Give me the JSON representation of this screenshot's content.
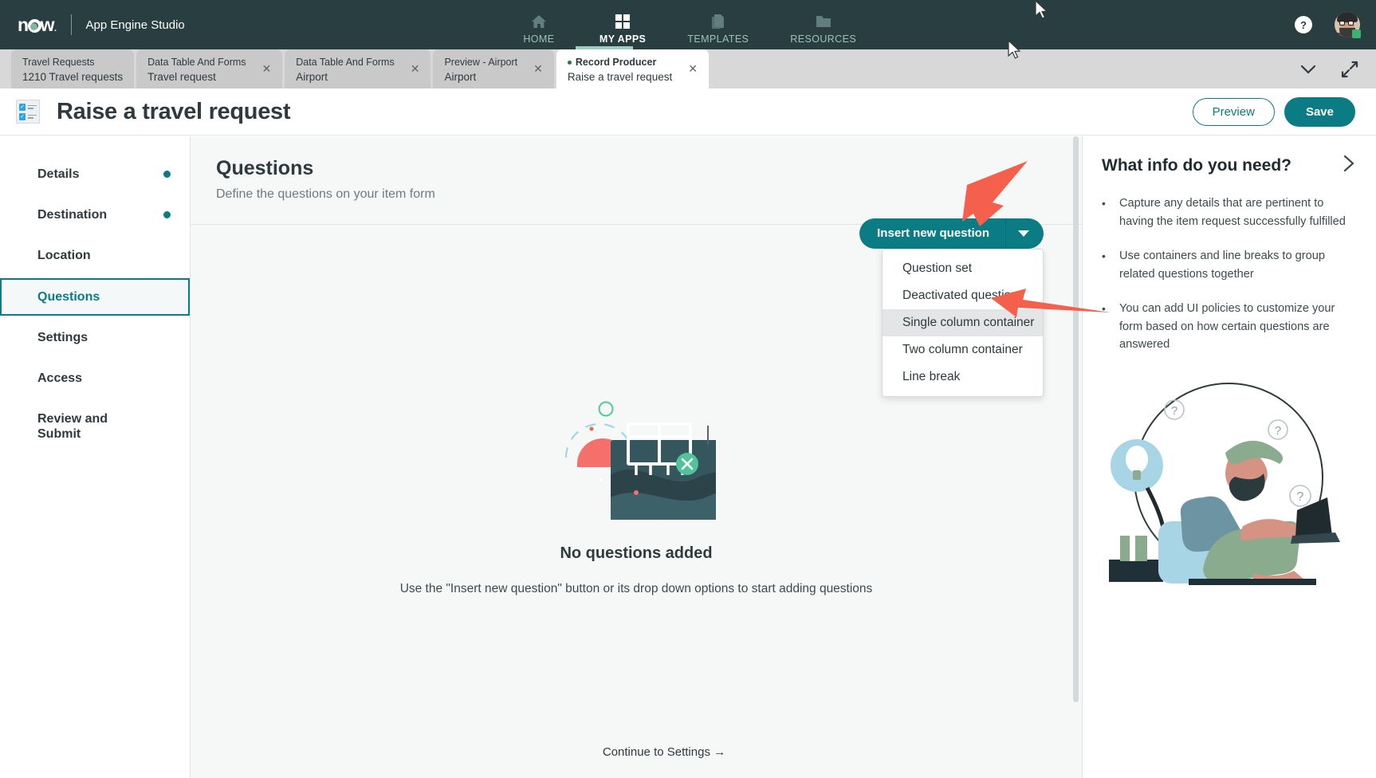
{
  "topbar": {
    "logo_text": "now",
    "product_name": "App Engine Studio",
    "nav": [
      {
        "label": "HOME",
        "icon": "home-icon",
        "active": false
      },
      {
        "label": "MY APPS",
        "icon": "grid-icon",
        "active": true
      },
      {
        "label": "TEMPLATES",
        "icon": "documents-icon",
        "active": false
      },
      {
        "label": "RESOURCES",
        "icon": "folder-icon",
        "active": false
      }
    ],
    "help_label": "?",
    "avatar_name": "user-avatar"
  },
  "tabs": [
    {
      "title": "Travel Requests",
      "subtitle": "1210 Travel requests",
      "active": false,
      "closable": false
    },
    {
      "title": "Data Table And Forms",
      "subtitle": "Travel request",
      "active": false,
      "closable": true
    },
    {
      "title": "Data Table And Forms",
      "subtitle": "Airport",
      "active": false,
      "closable": true
    },
    {
      "title": "Preview - Airport",
      "subtitle": "Airport",
      "active": false,
      "closable": true
    },
    {
      "title": "Record Producer",
      "subtitle": "Raise a travel request",
      "active": true,
      "closable": true
    }
  ],
  "tabbar_controls": {
    "collapse_label": "chevron-down-icon",
    "expand_label": "expand-icon"
  },
  "pagehead": {
    "title": "Raise a travel request",
    "preview_label": "Preview",
    "save_label": "Save"
  },
  "sidebar": {
    "items": [
      {
        "label": "Details",
        "dot": true,
        "active": false
      },
      {
        "label": "Destination",
        "dot": true,
        "active": false
      },
      {
        "label": "Location",
        "dot": false,
        "active": false
      },
      {
        "label": "Questions",
        "dot": false,
        "active": true
      },
      {
        "label": "Settings",
        "dot": false,
        "active": false
      },
      {
        "label": "Access",
        "dot": false,
        "active": false
      },
      {
        "label": "Review and Submit",
        "dot": false,
        "active": false
      }
    ]
  },
  "main": {
    "title": "Questions",
    "subtitle": "Define the questions on your item form",
    "insert_button_label": "Insert new question",
    "dropdown_items": [
      {
        "label": "Question set",
        "highlighted": false
      },
      {
        "label": "Deactivated questions",
        "highlighted": false
      },
      {
        "label": "Single column container",
        "highlighted": true
      },
      {
        "label": "Two column container",
        "highlighted": false
      },
      {
        "label": "Line break",
        "highlighted": false
      }
    ],
    "empty_title": "No questions added",
    "empty_subtitle": "Use the \"Insert new question\" button or its drop down options to start adding questions",
    "continue_label": "Continue to Settings →"
  },
  "info_panel": {
    "title": "What info do you need?",
    "bullets": [
      "Capture any details that are pertinent to having the item request successfully fulfilled",
      "Use containers and line breaks to group related questions together",
      "You can add UI policies to customize your form based on how certain questions are answered"
    ]
  },
  "colors": {
    "brand_dark": "#293e40",
    "accent_teal": "#0b7c84",
    "annotation_red": "#f4604c",
    "tabbar_grey": "#d8d8d8",
    "status_green": "#3bb273"
  }
}
